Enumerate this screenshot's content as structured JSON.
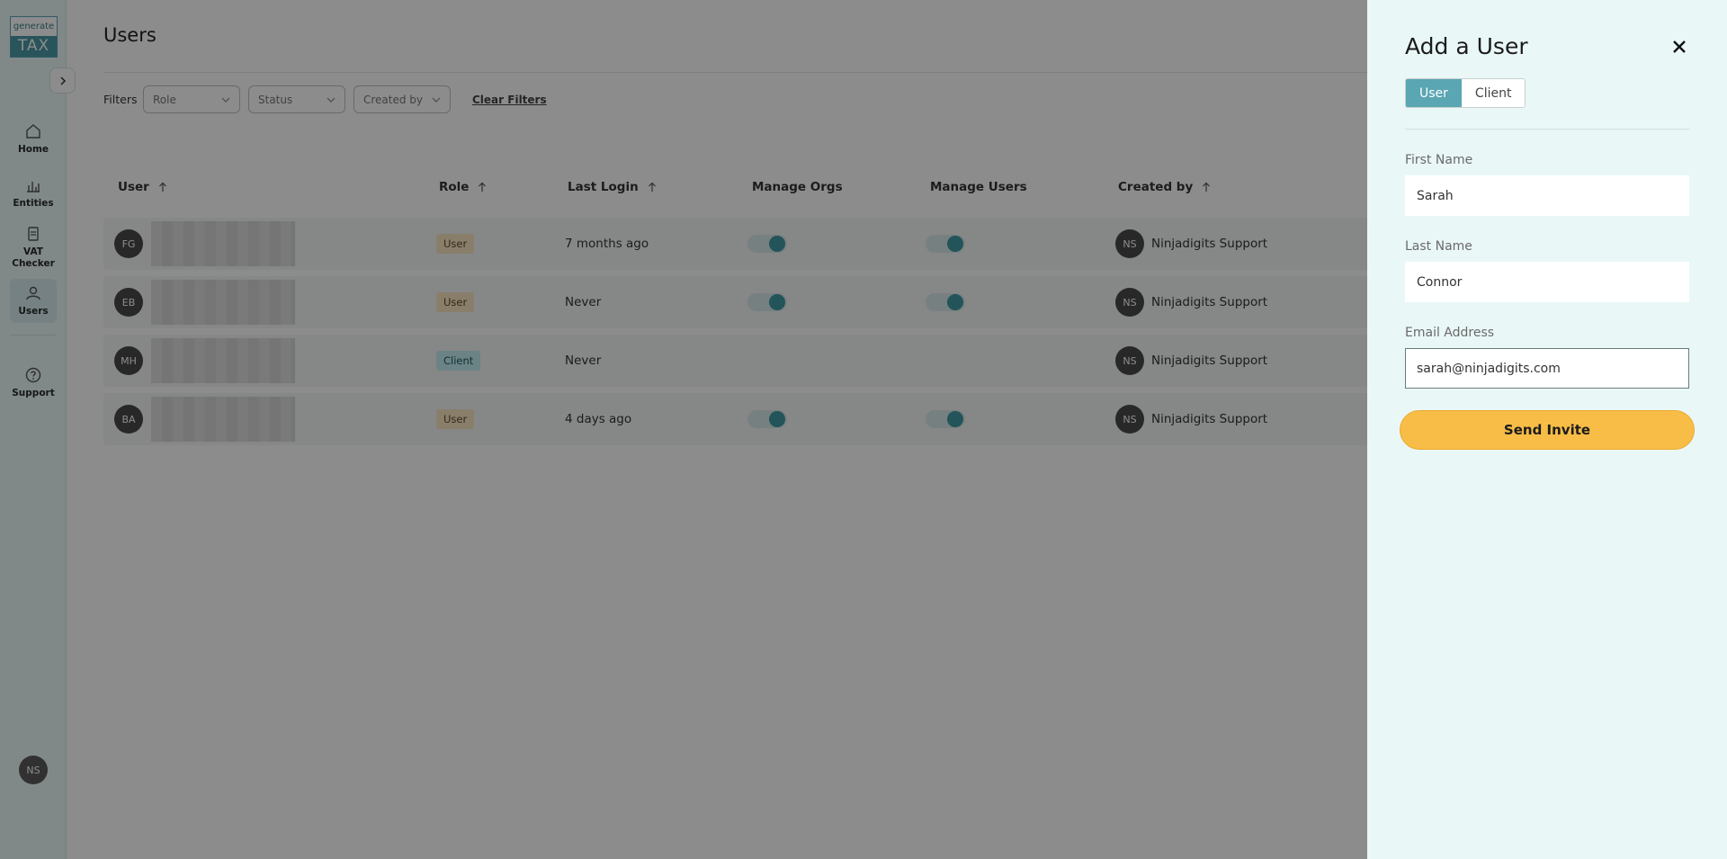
{
  "app": {
    "logo_top": "generate",
    "logo_bottom": "TAX"
  },
  "sidebar": {
    "items": [
      {
        "label": "Home",
        "icon": "home-icon"
      },
      {
        "label": "Entities",
        "icon": "chart-icon"
      },
      {
        "label": "VAT Checker",
        "icon": "clipboard-icon"
      },
      {
        "label": "Users",
        "icon": "user-icon"
      },
      {
        "label": "Support",
        "icon": "question-icon"
      }
    ],
    "user_initials": "NS"
  },
  "page": {
    "title": "Users",
    "filters_label": "Filters",
    "filters": [
      "Role",
      "Status",
      "Created by"
    ],
    "clear_filters": "Clear Filters"
  },
  "table": {
    "headers": [
      "User",
      "Role",
      "Last Login",
      "Manage Orgs",
      "Manage Users",
      "Created by"
    ],
    "rows": [
      {
        "initials": "FG",
        "role": "User",
        "last_login": "7 months ago",
        "manage_orgs": true,
        "manage_users": true,
        "created_by_initials": "NS",
        "created_by": "Ninjadigits Support"
      },
      {
        "initials": "EB",
        "role": "User",
        "last_login": "Never",
        "manage_orgs": true,
        "manage_users": true,
        "created_by_initials": "NS",
        "created_by": "Ninjadigits Support"
      },
      {
        "initials": "MH",
        "role": "Client",
        "last_login": "Never",
        "manage_orgs": false,
        "manage_users": false,
        "created_by_initials": "NS",
        "created_by": "Ninjadigits Support"
      },
      {
        "initials": "BA",
        "role": "User",
        "last_login": "4 days ago",
        "manage_orgs": true,
        "manage_users": true,
        "created_by_initials": "NS",
        "created_by": "Ninjadigits Support"
      }
    ]
  },
  "drawer": {
    "title": "Add a User",
    "tabs": [
      "User",
      "Client"
    ],
    "first_name_label": "First Name",
    "first_name_value": "Sarah",
    "last_name_label": "Last Name",
    "last_name_value": "Connor",
    "email_label": "Email Address",
    "email_value": "sarah@ninjadigits.com",
    "send_label": "Send Invite"
  },
  "colors": {
    "accent": "#5aa6b2",
    "send_button": "#f8bd47",
    "drawer_bg": "#eaf7f7"
  }
}
